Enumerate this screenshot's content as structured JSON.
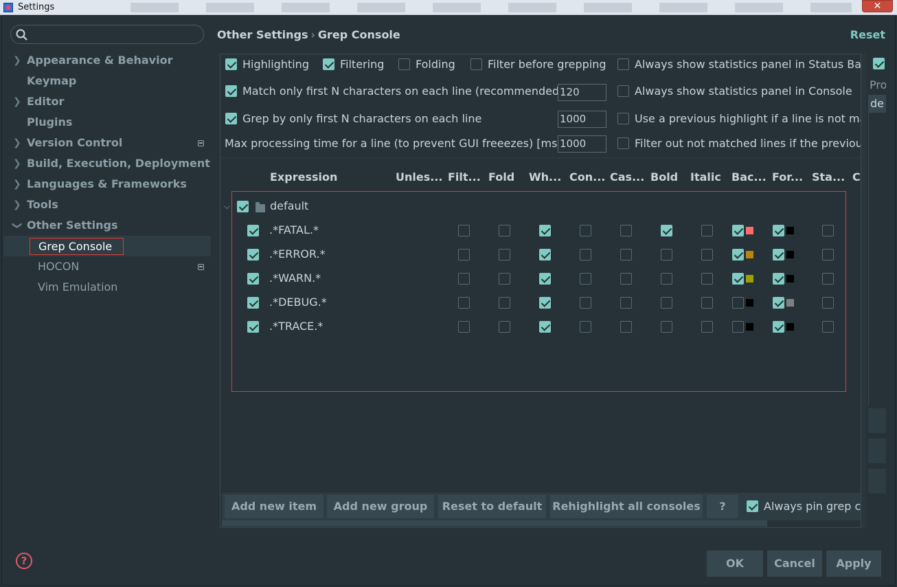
{
  "window": {
    "title": "Settings",
    "close_glyph": "✕"
  },
  "search": {
    "placeholder": "",
    "icon": "search-icon"
  },
  "sidebar": {
    "items": [
      {
        "label": "Appearance & Behavior",
        "expandable": true
      },
      {
        "label": "Keymap",
        "expandable": false
      },
      {
        "label": "Editor",
        "expandable": true
      },
      {
        "label": "Plugins",
        "expandable": false
      },
      {
        "label": "Version Control",
        "expandable": true
      },
      {
        "label": "Build, Execution, Deployment",
        "expandable": true
      },
      {
        "label": "Languages & Frameworks",
        "expandable": true
      },
      {
        "label": "Tools",
        "expandable": true
      },
      {
        "label": "Other Settings",
        "expandable": true,
        "expanded": true
      },
      {
        "label": "Grep Console",
        "selected": true
      },
      {
        "label": "HOCON"
      },
      {
        "label": "Vim Emulation"
      }
    ]
  },
  "header": {
    "crumb_parent": "Other Settings",
    "crumb_sep": "›",
    "crumb_current": "Grep Console",
    "reset": "Reset"
  },
  "options": {
    "highlighting": {
      "label": "Highlighting",
      "checked": true
    },
    "filtering": {
      "label": "Filtering",
      "checked": true
    },
    "folding": {
      "label": "Folding",
      "checked": false
    },
    "filter_before": {
      "label": "Filter before grepping",
      "checked": false
    },
    "match_first_n": {
      "label": "Match only first N characters on each line (recommended)",
      "checked": true,
      "value": "120"
    },
    "grep_first_n": {
      "label": "Grep by only first N characters on each line",
      "checked": true,
      "value": "1000"
    },
    "max_time": {
      "label": "Max processing time for a line (to prevent GUI freeezes) [ms]",
      "value": "1000"
    },
    "stats_status_bar": {
      "label": "Always show statistics panel in Status Bar",
      "checked": false
    },
    "stats_console": {
      "label": "Always show statistics panel in Console",
      "checked": false
    },
    "prev_highlight": {
      "label": "Use a previous highlight if a line is not matched",
      "checked": false
    },
    "filter_out": {
      "label": "Filter out not matched lines if the previous line was filtered",
      "checked": false
    }
  },
  "table": {
    "headers": [
      "Expression",
      "Unles...",
      "Filt...",
      "Fold",
      "Wh...",
      "Con...",
      "Cas...",
      "Bold",
      "Italic",
      "Bac...",
      "For...",
      "Sta...",
      "C"
    ],
    "group": {
      "name": "default",
      "checked": true
    },
    "rows": [
      {
        "expr": ".*FATAL.*",
        "enabled": true,
        "filter": false,
        "fold": false,
        "whole": true,
        "cont": false,
        "case": false,
        "bold": true,
        "italic": false,
        "bg_on": true,
        "bg_color": "#ff6b6b",
        "fg_on": true,
        "fg_color": "#000000",
        "stats": false
      },
      {
        "expr": ".*ERROR.*",
        "enabled": true,
        "filter": false,
        "fold": false,
        "whole": true,
        "cont": false,
        "case": false,
        "bold": false,
        "italic": false,
        "bg_on": true,
        "bg_color": "#b8860b",
        "fg_on": true,
        "fg_color": "#000000",
        "stats": false
      },
      {
        "expr": ".*WARN.*",
        "enabled": true,
        "filter": false,
        "fold": false,
        "whole": true,
        "cont": false,
        "case": false,
        "bold": false,
        "italic": false,
        "bg_on": true,
        "bg_color": "#a0a000",
        "fg_on": true,
        "fg_color": "#000000",
        "stats": false
      },
      {
        "expr": ".*DEBUG.*",
        "enabled": true,
        "filter": false,
        "fold": false,
        "whole": true,
        "cont": false,
        "case": false,
        "bold": false,
        "italic": false,
        "bg_on": false,
        "bg_color": "#000000",
        "fg_on": true,
        "fg_color": "#808080",
        "stats": false
      },
      {
        "expr": ".*TRACE.*",
        "enabled": true,
        "filter": false,
        "fold": false,
        "whole": true,
        "cont": false,
        "case": false,
        "bold": false,
        "italic": false,
        "bg_on": false,
        "bg_color": "#000000",
        "fg_on": true,
        "fg_color": "#000000",
        "stats": false
      }
    ]
  },
  "buttons": {
    "add_item": "Add new item",
    "add_group": "Add new group",
    "reset_default": "Reset to default",
    "rehighlight": "Rehighlight all consoles",
    "help": "?",
    "always_pin": {
      "label": "Always pin grep consoles",
      "checked": true
    }
  },
  "right_strip": {
    "text_1": "Pro",
    "text_2": "de"
  },
  "footer": {
    "ok": "OK",
    "cancel": "Cancel",
    "apply": "Apply"
  },
  "colors": {
    "accent": "#80cbc4",
    "background": "#263238",
    "highlight_border": "#e53935"
  }
}
